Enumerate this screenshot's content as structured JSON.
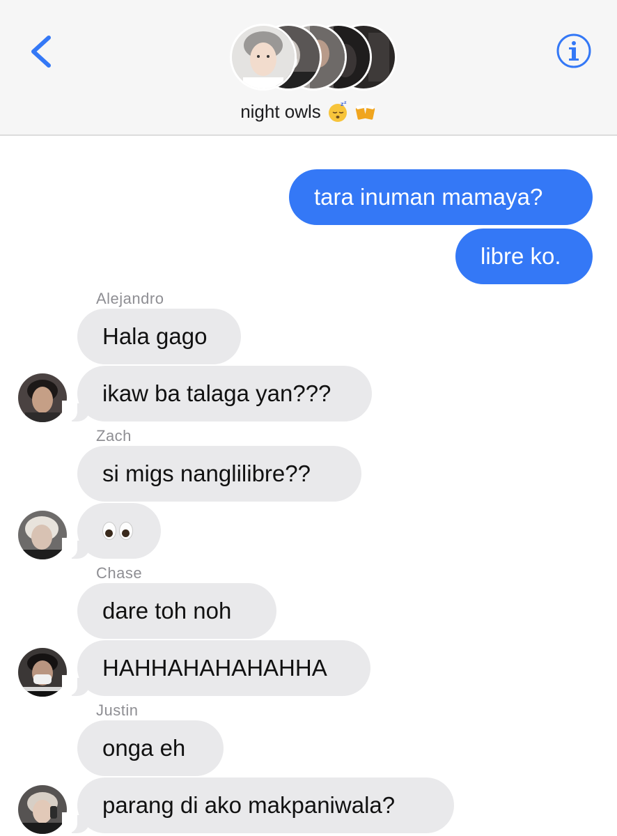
{
  "header": {
    "group_name": "night owls",
    "title_emojis": [
      "sleeping-face-emoji",
      "beer-mugs-emoji"
    ],
    "back_icon": "chevron-left-icon",
    "info_icon": "info-circle-icon"
  },
  "messages": {
    "outgoing": [
      {
        "text": "tara inuman mamaya?"
      },
      {
        "text": "libre ko."
      }
    ],
    "senders": [
      "Alejandro",
      "Zach",
      "Chase",
      "Justin"
    ],
    "incoming": [
      {
        "text": "Hala gago"
      },
      {
        "text": "ikaw ba talaga yan???"
      },
      {
        "text": "si migs nanglilibre??"
      },
      {
        "text": "",
        "emoji": "eyes-emoji"
      },
      {
        "text": "dare toh noh"
      },
      {
        "text": "HAHHAHAHAHAHHA"
      },
      {
        "text": "onga eh"
      },
      {
        "text": "parang di ako makpaniwala?"
      }
    ]
  },
  "colors": {
    "outgoing_bubble": "#3478f6",
    "incoming_bubble": "#e9e9eb",
    "accent": "#3478f6",
    "header_bg": "#f6f6f6"
  }
}
